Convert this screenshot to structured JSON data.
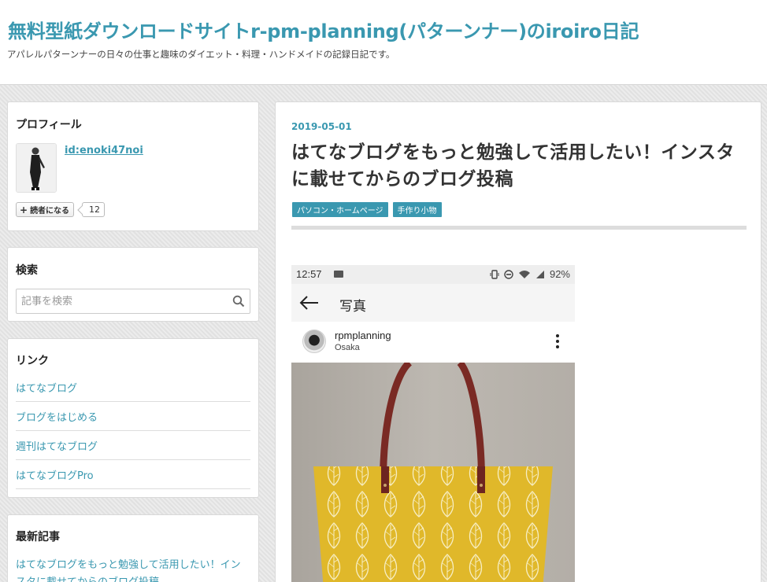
{
  "header": {
    "blog_title": "無料型紙ダウンロードサイトr-pm-planning(パターンナー)のiroiro日記",
    "blog_description": "アパレルパターンナーの日々の仕事と趣味のダイエット・料理・ハンドメイドの記録日記です。"
  },
  "sidebar": {
    "profile": {
      "title": "プロフィール",
      "user_id": "id:enoki47noi",
      "reader_button": "読者になる",
      "reader_count": "12"
    },
    "search": {
      "title": "検索",
      "placeholder": "記事を検索"
    },
    "links": {
      "title": "リンク",
      "items": [
        "はてなブログ",
        "ブログをはじめる",
        "週刊はてなブログ",
        "はてなブログPro"
      ]
    },
    "recent": {
      "title": "最新記事",
      "items": [
        "はてなブログをもっと勉強して活用したい！インスタに載せてからのブログ投稿"
      ]
    }
  },
  "article": {
    "date": "2019-05-01",
    "title": "はてなブログをもっと勉強して活用したい！インスタに載せてからのブログ投稿",
    "categories": [
      "パソコン・ホームページ",
      "手作り小物"
    ],
    "screenshot": {
      "time": "12:57",
      "battery": "92%",
      "app_title": "写真",
      "username": "rpmplanning",
      "location": "Osaka"
    }
  },
  "colors": {
    "accent": "#3a98b0",
    "background": "#e6e6e6",
    "bag_yellow": "#e0b82a",
    "strap_leather": "#7a2a24"
  },
  "icons": [
    "plus-icon",
    "search-icon",
    "mail-icon",
    "back-arrow-icon",
    "more-icon"
  ]
}
